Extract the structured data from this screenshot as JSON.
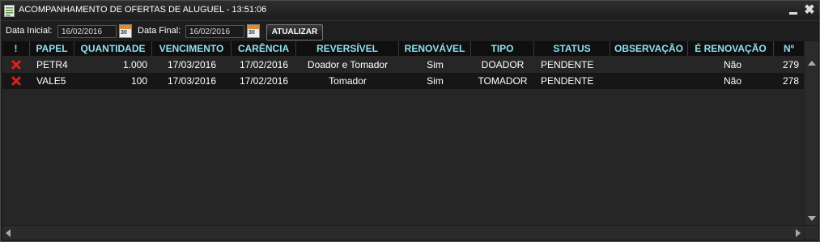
{
  "window": {
    "title": "ACOMPANHAMENTO DE OFERTAS DE ALUGUEL - 13:51:06",
    "minimize_icon": "minimize-icon",
    "close_icon": "close-icon",
    "close_glyph": "✖"
  },
  "filters": {
    "start_label": "Data Inicial:",
    "start_value": "16/02/2016",
    "end_label": "Data Final:",
    "end_value": "16/02/2016",
    "calendar_icon": "calendar-icon",
    "calendar_day": "30",
    "refresh_label": "ATUALIZAR"
  },
  "table": {
    "columns": [
      "!",
      "PAPEL",
      "QUANTIDADE",
      "VENCIMENTO",
      "CARÊNCIA",
      "REVERSÍVEL",
      "RENOVÁVEL",
      "TIPO",
      "STATUS",
      "OBSERVAÇÃO",
      "É RENOVAÇÃO",
      "Nº"
    ],
    "rows": [
      {
        "cancel_icon": "cancel-icon",
        "papel": "PETR4",
        "quantidade": "1.000",
        "vencimento": "17/03/2016",
        "carencia": "17/02/2016",
        "reversivel": "Doador e Tomador",
        "renovavel": "Sim",
        "tipo": "DOADOR",
        "status": "PENDENTE",
        "observacao": "",
        "e_renovacao": "Não",
        "numero": "279"
      },
      {
        "cancel_icon": "cancel-icon",
        "papel": "VALE5",
        "quantidade": "100",
        "vencimento": "17/03/2016",
        "carencia": "17/02/2016",
        "reversivel": "Tomador",
        "renovavel": "Sim",
        "tipo": "TOMADOR",
        "status": "PENDENTE",
        "observacao": "",
        "e_renovacao": "Não",
        "numero": "278"
      }
    ]
  },
  "colors": {
    "header_text": "#8fe0f0",
    "cancel_red": "#e0201a",
    "background": "#262626"
  }
}
